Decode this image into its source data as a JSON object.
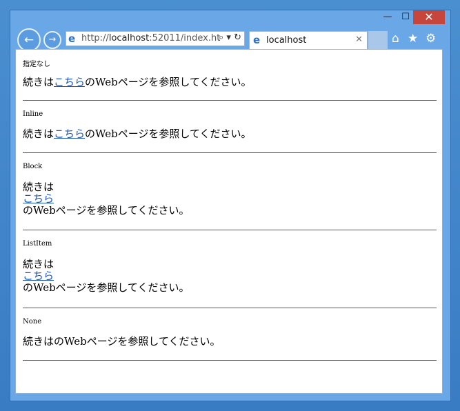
{
  "browser": {
    "url_prefix": "http://",
    "url_host": "localhost",
    "url_rest": ":52011/index.ht",
    "tab_title": "localhost",
    "window_buttons": {
      "minimize": "—",
      "maximize": "☐",
      "close": "✕"
    },
    "nav_glyphs": {
      "back": "←",
      "forward": "→",
      "search": "⌕ ▾",
      "refresh": "↻",
      "tab_close": "✕"
    },
    "toolbar_icons": [
      "home-icon",
      "favorites-star-icon",
      "tools-gear-icon"
    ]
  },
  "page": {
    "sections": [
      {
        "label": "指定なし",
        "before": "続きは",
        "link": "こちら",
        "after": "のWebページを参照してください。"
      },
      {
        "label": "Inline",
        "before": "続きは",
        "link": "こちら",
        "after": "のWebページを参照してください。"
      },
      {
        "label": "Block",
        "before": "続きは",
        "link": "こちら",
        "after": "のWebページを参照してください。"
      },
      {
        "label": "ListItem",
        "before": "続きは",
        "link": "こちら",
        "after": "のWebページを参照してください。"
      },
      {
        "label": "None",
        "before": "続きは",
        "link": "",
        "after": "のWebページを参照してください。"
      }
    ]
  },
  "colors": {
    "accent": "#1a57b8",
    "close": "#c7463c"
  }
}
